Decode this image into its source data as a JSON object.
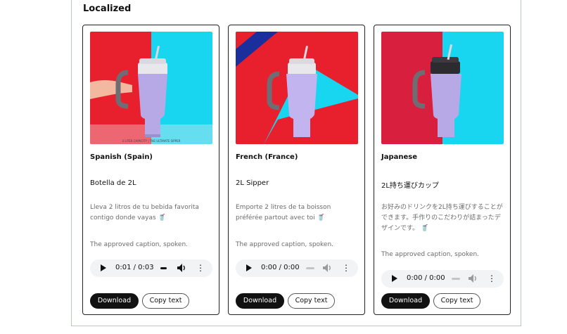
{
  "section": {
    "title": "Localized"
  },
  "cards": [
    {
      "language": "Spanish (Spain)",
      "headline": "Botella de 2L",
      "caption": "Lleva 2 litros de tu bebida favorita contigo donde vayas",
      "caption_emoji": "🥤",
      "approved": "The approved caption, spoken.",
      "audio": {
        "time": "0:01 / 0:03",
        "progress": 0.33
      },
      "download_label": "Download",
      "copy_label": "Copy text",
      "image_banner": "2 LITER CAPACITY | THE ULTIMATE SIPPER"
    },
    {
      "language": "French (France)",
      "headline": "2L Sipper",
      "caption": "Emporte 2 litres de ta boisson préférée partout avec toi",
      "caption_emoji": "🥤",
      "approved": "The approved caption, spoken.",
      "audio": {
        "time": "0:00 / 0:00",
        "progress": 0
      },
      "download_label": "Download",
      "copy_label": "Copy text"
    },
    {
      "language": "Japanese",
      "headline": "2L持ち運びカップ",
      "caption": "お好みのドリンクを2L持ち運びすることができます。手作りのこだわりが詰まったデザインです。",
      "caption_emoji": "🥤",
      "approved": "The approved caption, spoken.",
      "audio": {
        "time": "0:00 / 0:00",
        "progress": 0
      },
      "download_label": "Download",
      "copy_label": "Copy text"
    }
  ],
  "colors": {
    "red": "#e8202e",
    "cyan": "#19d6f0",
    "tumbler": "#b6a9e6",
    "crimson": "#d81f3d"
  }
}
